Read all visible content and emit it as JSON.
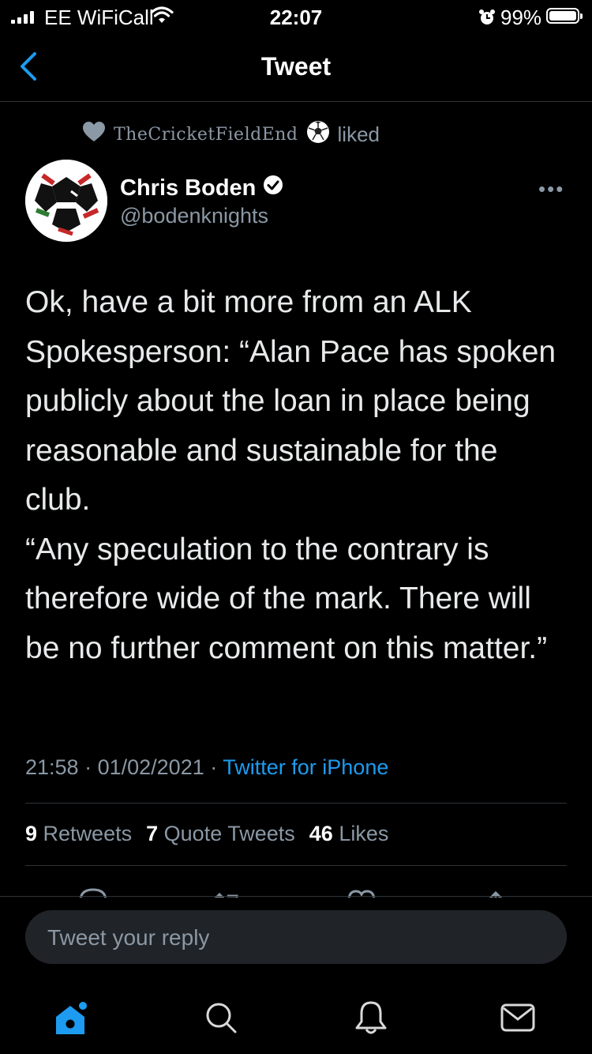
{
  "status_bar": {
    "carrier": "EE WiFiCall",
    "time": "22:07",
    "battery": "99%"
  },
  "header": {
    "title": "Tweet",
    "back_icon": "chevron-left-icon"
  },
  "social_context": {
    "liker": "TheCricketFieldEnd",
    "action": "liked"
  },
  "author": {
    "name": "Chris Boden",
    "handle": "@bodenknights",
    "verified": true
  },
  "tweet": {
    "lines": [
      "Ok, have a bit more from an ALK Spokesperson: “Alan Pace has spoken publicly about the loan in place being reasonable and sustainable for the club.",
      "“Any speculation to the contrary is therefore wide of the mark. There will be no further comment on this matter.”"
    ],
    "time": "21:58",
    "date": "01/02/2021",
    "source": "Twitter for iPhone"
  },
  "stats": {
    "retweets_count": "9",
    "retweets_label": "Retweets",
    "quotes_count": "7",
    "quotes_label": "Quote Tweets",
    "likes_count": "46",
    "likes_label": "Likes"
  },
  "reply": {
    "placeholder": "Tweet your reply"
  },
  "tab_bar": {
    "items": [
      "home-icon",
      "search-icon",
      "notifications-icon",
      "messages-icon"
    ]
  },
  "colors": {
    "accent": "#1d9bf0",
    "background": "#000000",
    "secondary_text": "#8b98a5"
  }
}
